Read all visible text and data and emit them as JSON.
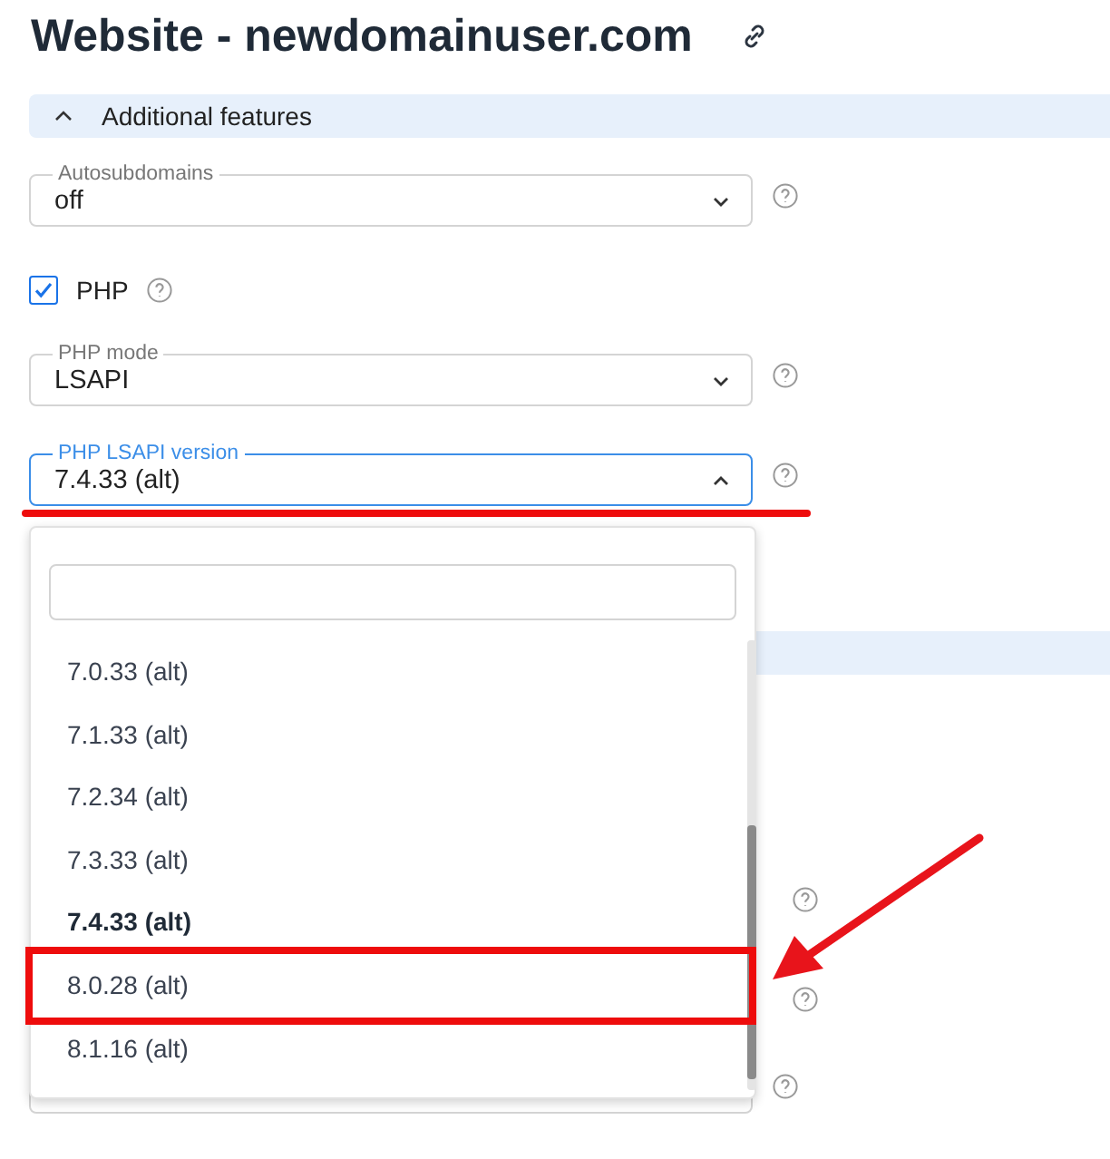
{
  "page": {
    "title": "Website - newdomainuser.com"
  },
  "section": {
    "title": "Additional features",
    "expanded": true
  },
  "fields": [
    {
      "kind": "select",
      "label": "Autosubdomains",
      "value": "off",
      "open": false
    },
    {
      "kind": "checkbox",
      "label": "PHP",
      "checked": true
    },
    {
      "kind": "select",
      "label": "PHP mode",
      "value": "LSAPI",
      "open": false
    },
    {
      "kind": "select",
      "label": "PHP LSAPI version",
      "value": "7.4.33 (alt)",
      "open": true
    }
  ],
  "dropdown": {
    "options": [
      {
        "label": "7.0.33 (alt)",
        "selected": false,
        "highlighted": false
      },
      {
        "label": "7.1.33 (alt)",
        "selected": false,
        "highlighted": false
      },
      {
        "label": "7.2.34 (alt)",
        "selected": false,
        "highlighted": false
      },
      {
        "label": "7.3.33 (alt)",
        "selected": false,
        "highlighted": false
      },
      {
        "label": "7.4.33 (alt)",
        "selected": true,
        "highlighted": false
      },
      {
        "label": "8.0.28 (alt)",
        "selected": false,
        "highlighted": true
      },
      {
        "label": "8.1.16 (alt)",
        "selected": false,
        "highlighted": false
      }
    ]
  }
}
